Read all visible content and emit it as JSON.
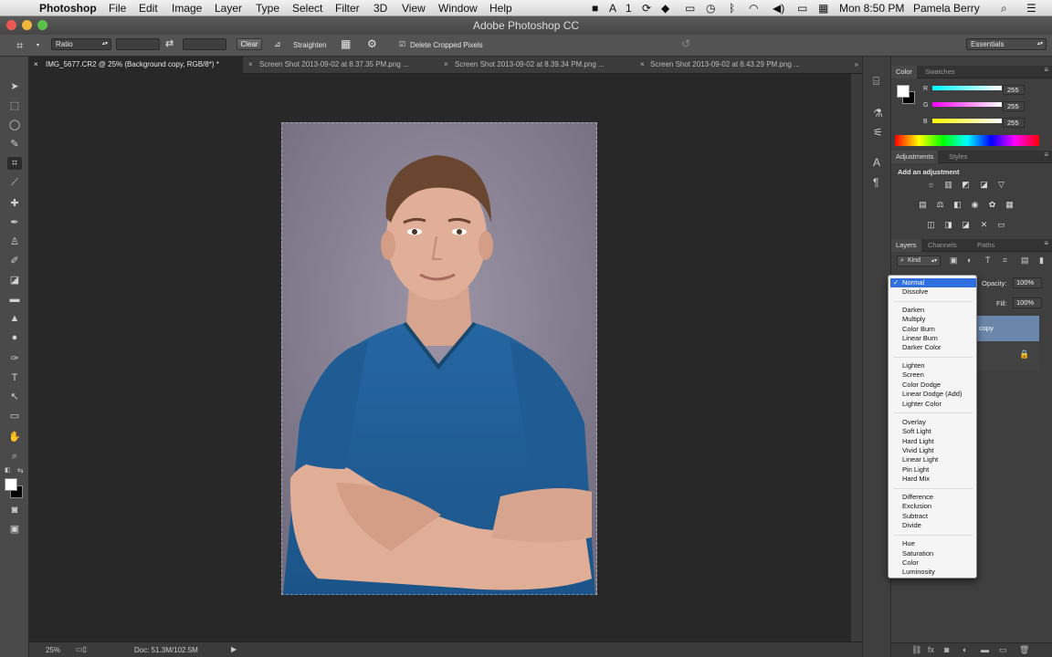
{
  "menubar": {
    "app_name": "Photoshop",
    "menus": [
      "File",
      "Edit",
      "Image",
      "Layer",
      "Type",
      "Select",
      "Filter",
      "3D",
      "View",
      "Window",
      "Help"
    ],
    "status_text": "1",
    "clock": "Mon 8:50 PM",
    "user": "Pamela Berry"
  },
  "title": "Adobe Photoshop CC",
  "options": {
    "ratio_label": "Ratio",
    "clear_label": "Clear",
    "straighten_label": "Straighten",
    "delete_cropped_label": "Delete Cropped Pixels",
    "workspace": "Essentials"
  },
  "tabs": [
    {
      "label": "IMG_5677.CR2 @ 25% (Background copy, RGB/8*) *"
    },
    {
      "label": "Screen Shot 2013-09-02 at 8.37.35 PM.png ..."
    },
    {
      "label": "Screen Shot 2013-09-02 at 8.39.34 PM.png ..."
    },
    {
      "label": "Screen Shot 2013-09-02 at 8.43.29 PM.png ..."
    }
  ],
  "status": {
    "zoom": "25%",
    "doc": "Doc: 51.3M/102.5M"
  },
  "color_panel": {
    "tabs": [
      "Color",
      "Swatches"
    ],
    "r_label": "R",
    "g_label": "G",
    "b_label": "B",
    "r": "255",
    "g": "255",
    "b": "255"
  },
  "adjustments_panel": {
    "tabs": [
      "Adjustments",
      "Styles"
    ],
    "heading": "Add an adjustment"
  },
  "layers_panel": {
    "tabs": [
      "Layers",
      "Channels",
      "Paths"
    ],
    "kind_label": "Kind",
    "opacity_label": "Opacity:",
    "opacity_value": "100%",
    "fill_label": "Fill:",
    "fill_value": "100%",
    "layer_name_partial": "copy"
  },
  "blend_menu": {
    "checkmark": "✓",
    "selected": "Normal",
    "options": [
      "Normal",
      "Dissolve",
      "Darken",
      "Multiply",
      "Color Burn",
      "Linear Burn",
      "Darker Color",
      "Lighten",
      "Screen",
      "Color Dodge",
      "Linear Dodge (Add)",
      "Lighter Color",
      "Overlay",
      "Soft Light",
      "Hard Light",
      "Vivid Light",
      "Linear Light",
      "Pin Light",
      "Hard Mix",
      "Difference",
      "Exclusion",
      "Subtract",
      "Divide",
      "Hue",
      "Saturation",
      "Color",
      "Luminosity"
    ]
  },
  "colors": {
    "accent": "#2f6fe0",
    "shirt": "#1f5c93",
    "backdrop": "#8c8699"
  }
}
